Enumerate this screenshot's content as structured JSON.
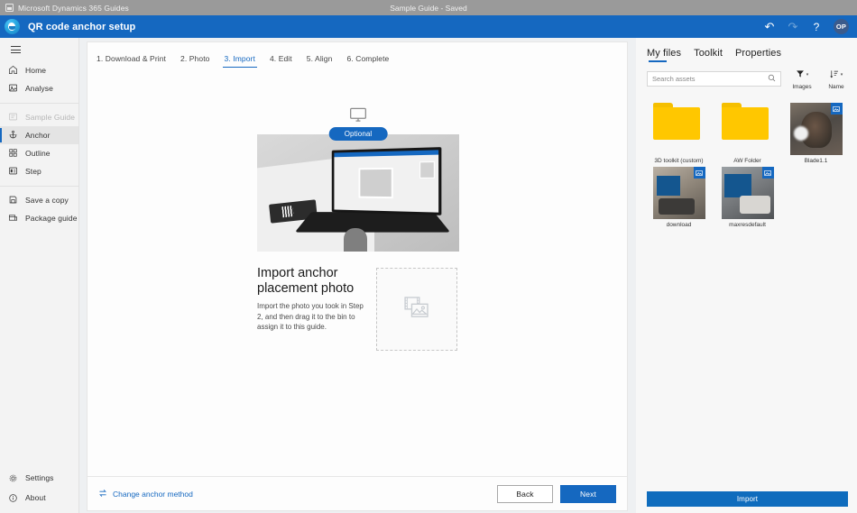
{
  "titlebar": {
    "app_name": "Microsoft Dynamics 365 Guides",
    "document_title": "Sample Guide - Saved",
    "app_icon": "window-icon"
  },
  "commandbar": {
    "title": "QR code anchor setup",
    "logo_icon": "guides-logo-icon",
    "undo_icon": "undo-icon",
    "redo_icon": "redo-icon",
    "help_icon": "help-icon",
    "avatar_initials": "OP",
    "accent_color": "#1568c0"
  },
  "sidebar": {
    "menu_icon": "hamburger-icon",
    "items": [
      {
        "label": "Home",
        "icon": "home-icon",
        "state": "normal"
      },
      {
        "label": "Analyse",
        "icon": "analyse-icon",
        "state": "normal"
      },
      {
        "label": "Sample Guide",
        "icon": "guide-icon",
        "state": "disabled"
      },
      {
        "label": "Anchor",
        "icon": "anchor-icon",
        "state": "selected"
      },
      {
        "label": "Outline",
        "icon": "outline-icon",
        "state": "normal"
      },
      {
        "label": "Step",
        "icon": "step-icon",
        "state": "normal"
      },
      {
        "label": "Save a copy",
        "icon": "save-icon",
        "state": "normal"
      },
      {
        "label": "Package guide",
        "icon": "package-icon",
        "state": "normal"
      }
    ],
    "bottom_items": [
      {
        "label": "Settings",
        "icon": "gear-icon"
      },
      {
        "label": "About",
        "icon": "info-icon"
      }
    ]
  },
  "wizard": {
    "steps": [
      {
        "label": "1. Download & Print",
        "active": false
      },
      {
        "label": "2. Photo",
        "active": false
      },
      {
        "label": "3. Import",
        "active": true
      },
      {
        "label": "4. Edit",
        "active": false
      },
      {
        "label": "5. Align",
        "active": false
      },
      {
        "label": "6. Complete",
        "active": false
      }
    ],
    "hero": {
      "device_icon": "desktop-monitor-icon",
      "badge": "Optional",
      "photo_alt": "laptop-illustration"
    },
    "heading": "Import anchor placement photo",
    "description": "Import the photo you took in Step 2, and then drag it to the bin to assign it to this guide.",
    "dropzone_icon": "image-placeholder-icon",
    "footer": {
      "change_link": "Change anchor method",
      "change_icon": "swap-icon",
      "back_label": "Back",
      "next_label": "Next"
    }
  },
  "rightpanel": {
    "tabs": [
      {
        "label": "My files",
        "active": true
      },
      {
        "label": "Toolkit",
        "active": false
      },
      {
        "label": "Properties",
        "active": false
      }
    ],
    "search": {
      "placeholder": "Search assets",
      "value": "",
      "icon": "search-icon"
    },
    "filter": {
      "label": "Images",
      "icon": "filter-icon",
      "chevron": "chevron-down-icon"
    },
    "sort": {
      "label": "Name",
      "icon": "sort-icon",
      "chevron": "chevron-down-icon"
    },
    "files": [
      {
        "name": "3D toolkit (custom)",
        "type": "folder",
        "badge": ""
      },
      {
        "name": "AW Folder",
        "type": "folder",
        "badge": ""
      },
      {
        "name": "Blade1.1",
        "type": "image",
        "badge": "image-badge-icon",
        "style": "ph-blade"
      },
      {
        "name": "download",
        "type": "image",
        "badge": "image-badge-icon",
        "style": "ph-download"
      },
      {
        "name": "maxresdefault",
        "type": "image",
        "badge": "image-badge-icon",
        "style": "ph-max"
      }
    ],
    "import_label": "Import"
  }
}
